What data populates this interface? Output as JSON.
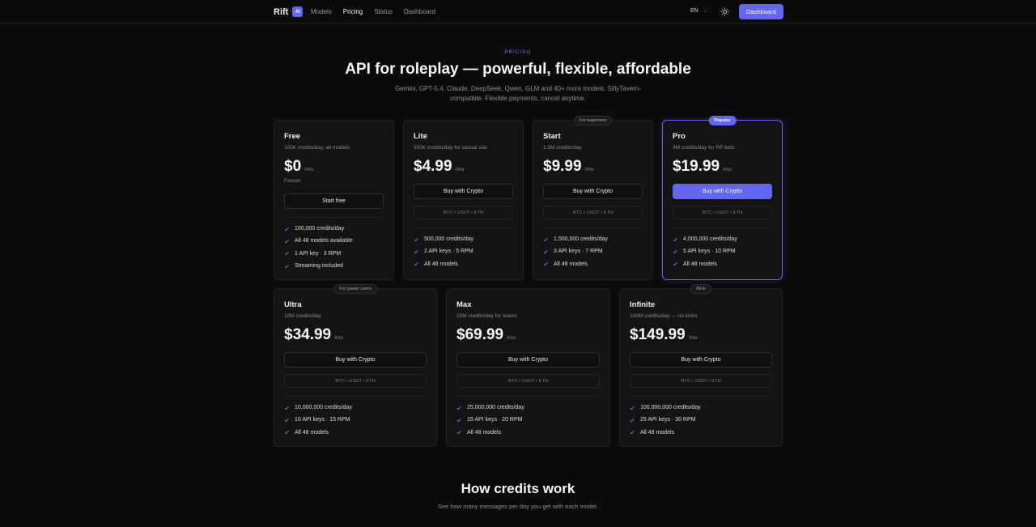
{
  "nav": {
    "brand": "Rift",
    "brand_badge": "AI",
    "links": [
      "Models",
      "Pricing",
      "Status",
      "Dashboard"
    ],
    "active": "Pricing",
    "lang": "EN",
    "theme_icon": "sun-icon",
    "dashboard_button": "Dashboard"
  },
  "hero": {
    "eyebrow": "PRICING",
    "title": "API for roleplay — powerful, flexible, affordable",
    "subtitle": "Gemini, GPT-5.4, Claude, DeepSeek, Qwen, GLM and 40+ more models. SillyTavern-compatible. Flexible payments, cancel anytime."
  },
  "plans": [
    {
      "name": "Free",
      "desc": "100K credits/day, all models",
      "price": "$0",
      "period": "/mo",
      "note": "Forever",
      "button": "Start free",
      "features": [
        "100,000 credits/day",
        "All 48 models available",
        "1 API key · 3 RPM",
        "Streaming included"
      ]
    },
    {
      "name": "Lite",
      "desc": "500K credits/day for casual use",
      "price": "$4.99",
      "period": "/mo",
      "button": "Buy with Crypto",
      "payments": "BTC • USDT • ETH",
      "features": [
        "500,000 credits/day",
        "2 API keys · 5 RPM",
        "All 48 models"
      ]
    },
    {
      "name": "Start",
      "tag": "For beginners",
      "desc": "1.5M credits/day",
      "price": "$9.99",
      "period": "/mo",
      "button": "Buy with Crypto",
      "payments": "BTC • USDT • ETH",
      "features": [
        "1,500,000 credits/day",
        "3 API keys · 7 RPM",
        "All 48 models"
      ]
    },
    {
      "name": "Pro",
      "tag": "Popular",
      "desc": "4M credits/day for RP bots",
      "price": "$19.99",
      "period": "/mo",
      "button": "Buy with Crypto",
      "payments": "BTC • USDT • ETH",
      "features": [
        "4,000,000 credits/day",
        "5 API keys · 10 RPM",
        "All 48 models"
      ]
    },
    {
      "name": "Ultra",
      "tag": "For power users",
      "desc": "10M credits/day",
      "price": "$34.99",
      "period": "/mo",
      "button": "Buy with Crypto",
      "payments": "BTC • USDT • ETH",
      "features": [
        "10,000,000 credits/day",
        "10 API keys · 15 RPM",
        "All 48 models"
      ]
    },
    {
      "name": "Max",
      "desc": "25M credits/day for teams",
      "price": "$69.99",
      "period": "/mo",
      "button": "Buy with Crypto",
      "payments": "BTC • USDT • ETH",
      "features": [
        "25,000,000 credits/day",
        "15 API keys · 20 RPM",
        "All 48 models"
      ]
    },
    {
      "name": "Infinite",
      "tag": "All-in",
      "desc": "100M credits/day — no limits",
      "price": "$149.99",
      "period": "/mo",
      "button": "Buy with Crypto",
      "payments": "BTC • USDT • ETH",
      "features": [
        "100,000,000 credits/day",
        "25 API keys · 30 RPM",
        "All 48 models"
      ]
    }
  ],
  "credits": {
    "title": "How credits work",
    "subtitle": "See how many messages per day you get with each model."
  },
  "colors": {
    "accent": "#6366f1",
    "background": "#0b0b0b",
    "card": "#141414"
  }
}
